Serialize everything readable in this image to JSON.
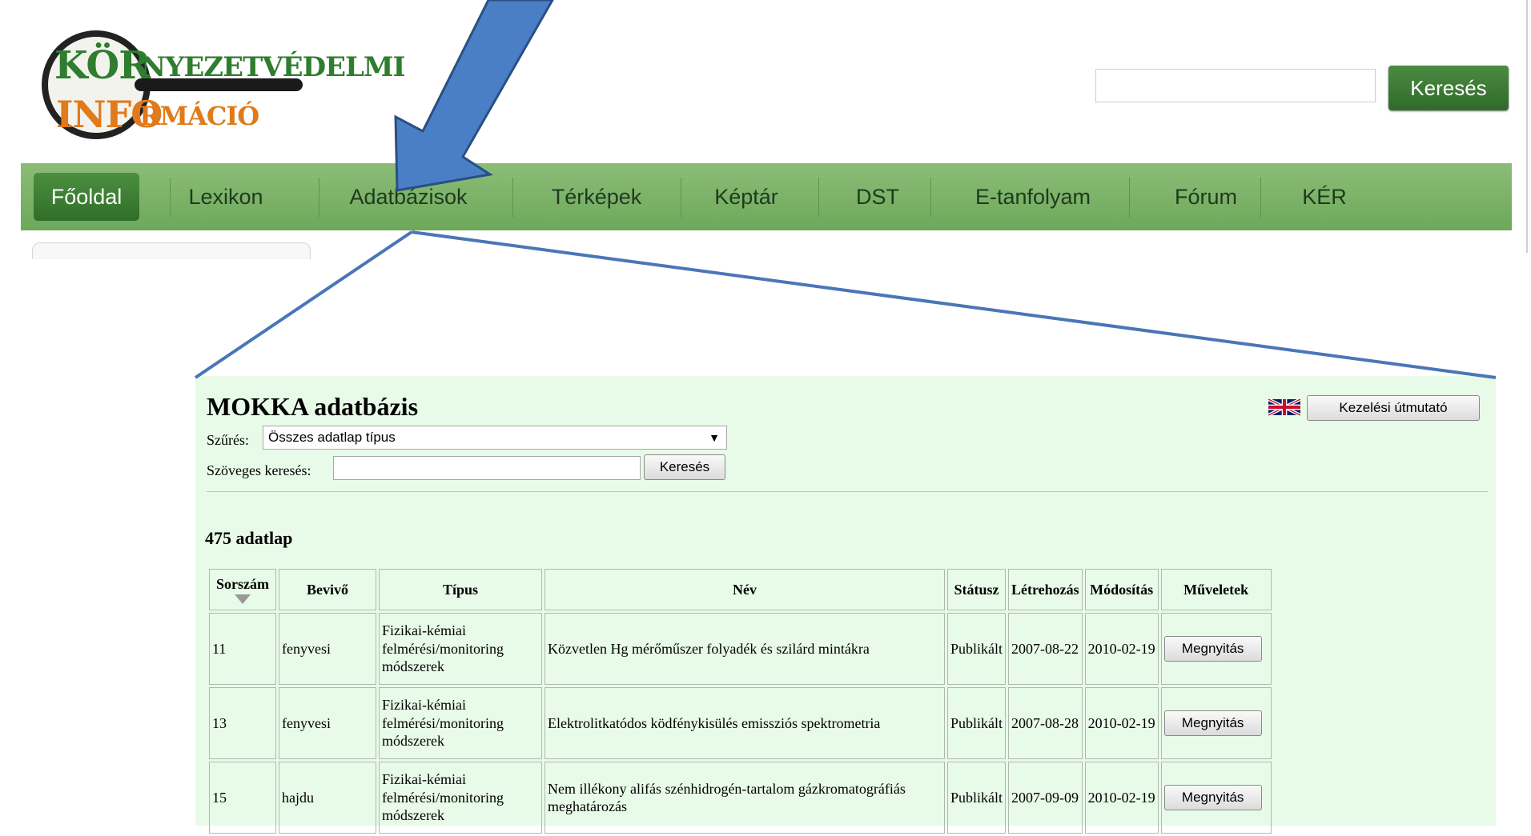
{
  "site": {
    "logo_line1_a": "KÖR",
    "logo_line1_b": "NYEZETVÉDELMI",
    "logo_line2_a": "INFO",
    "logo_line2_b": "RMÁCIÓ",
    "search_button": "Keresés"
  },
  "nav": [
    {
      "label": "Főoldal",
      "active": true
    },
    {
      "label": "Lexikon"
    },
    {
      "label": "Adatbázisok"
    },
    {
      "label": "Térképek"
    },
    {
      "label": "Képtár"
    },
    {
      "label": "DST"
    },
    {
      "label": "E-tanfolyam"
    },
    {
      "label": "Fórum"
    },
    {
      "label": "KÉR"
    }
  ],
  "panel": {
    "title": "MOKKA adatbázis",
    "help_button": "Kezelési útmutató",
    "filter_label": "Szűrés:",
    "filter_value": "Összes adatlap típus",
    "text_search_label": "Szöveges keresés:",
    "text_search_button": "Keresés",
    "count": "475 adatlap",
    "columns": [
      "Sorszám",
      "Bevivő",
      "Típus",
      "Név",
      "Státusz",
      "Létrehozás",
      "Módosítás",
      "Műveletek"
    ],
    "rows": [
      {
        "id": "11",
        "by": "fenyvesi",
        "type": "Fizikai-kémiai felmérési/monitoring módszerek",
        "name": "Közvetlen Hg mérőműszer folyadék és szilárd mintákra",
        "status": "Publikált",
        "created": "2007-08-22",
        "modified": "2010-02-19",
        "action": "Megnyitás"
      },
      {
        "id": "13",
        "by": "fenyvesi",
        "type": "Fizikai-kémiai felmérési/monitoring módszerek",
        "name": "Elektrolitkatódos ködfénykisülés emissziós spektrometria",
        "status": "Publikált",
        "created": "2007-08-28",
        "modified": "2010-02-19",
        "action": "Megnyitás"
      },
      {
        "id": "15",
        "by": "hajdu",
        "type": "Fizikai-kémiai felmérési/monitoring módszerek",
        "name": "Nem illékony alifás szénhidrogén-tartalom gázkromatográfiás meghatározás",
        "status": "Publikált",
        "created": "2007-09-09",
        "modified": "2010-02-19",
        "action": "Megnyitás"
      }
    ]
  },
  "colors": {
    "nav_green": "#7cb268",
    "active_green": "#3a7a33",
    "panel_bg": "#e8fbe8",
    "callout_blue": "#4a76b8"
  }
}
